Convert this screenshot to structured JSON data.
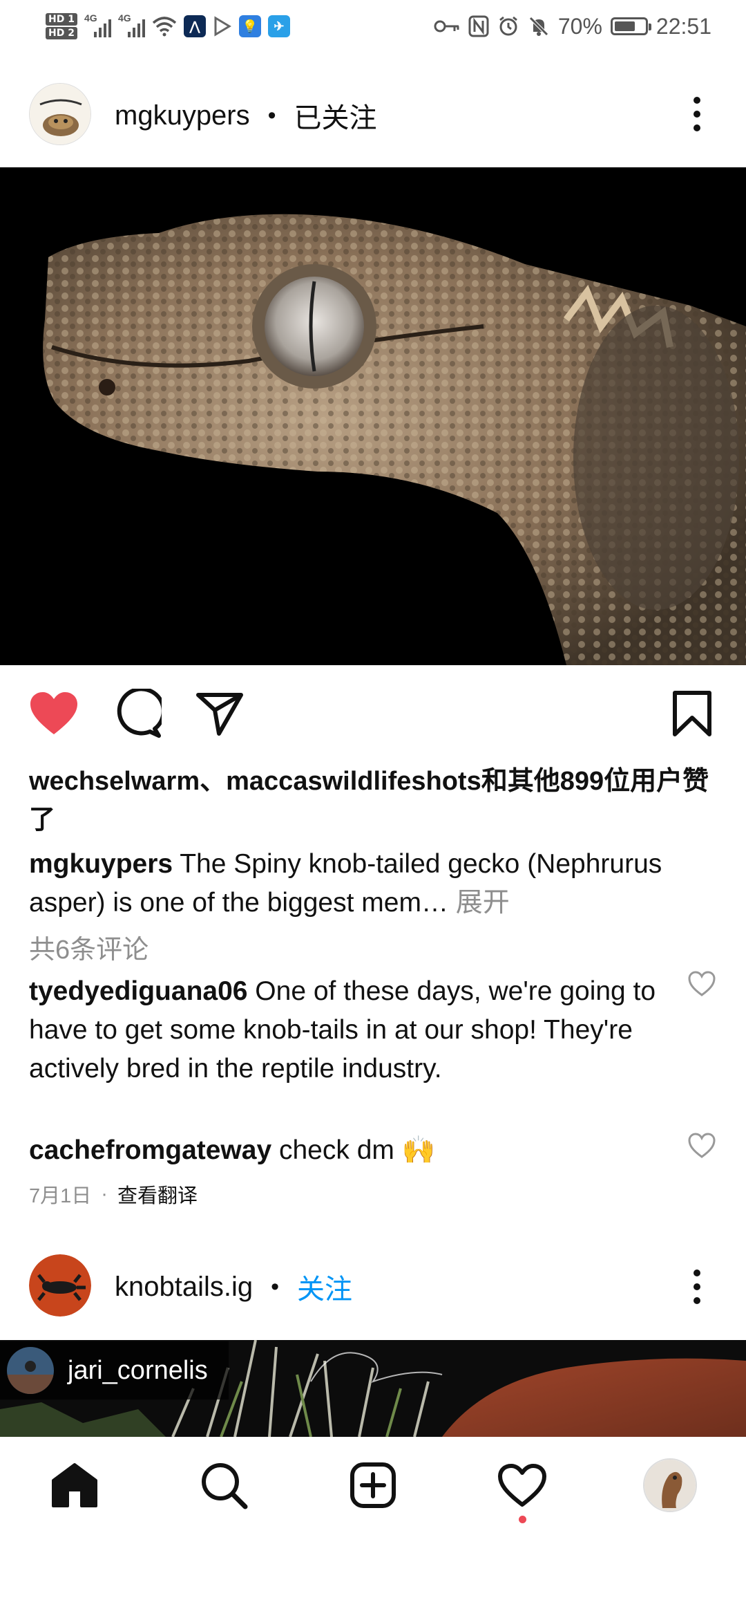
{
  "status_bar": {
    "hd1": "HD 1",
    "hd2": "HD 2",
    "signal1_label": "4G",
    "signal2_label": "4G",
    "battery_percent": "70%",
    "battery_level": 0.7,
    "time": "22:51"
  },
  "post1": {
    "username": "mgkuypers",
    "separator": "•",
    "follow_status": "已关注",
    "liked_by": "wechselwarm、maccaswildlifeshots和其他899位用户赞了",
    "caption_username": "mgkuypers",
    "caption_text": " The Spiny knob-tailed gecko (Nephrurus asper) is one of the biggest mem…",
    "caption_expand": " 展开",
    "view_all_comments": "共6条评论",
    "comments": [
      {
        "username": "tyedyediguana06",
        "text": " One of these days, we're going to have to get some knob-tails in at our shop! They're actively bred in the reptile industry."
      },
      {
        "username": "cachefromgateway",
        "text": " check dm 🙌"
      }
    ],
    "date": "7月1日",
    "meta_separator": "·",
    "translate": "查看翻译",
    "liked": true
  },
  "post2": {
    "username": "knobtails.ig",
    "separator": "•",
    "follow_action": "关注",
    "tagged_user": "jari_cornelis"
  },
  "colors": {
    "like_red": "#ed4956",
    "follow_blue": "#0095f6",
    "secondary_gray": "#8e8e8e",
    "text": "#111111"
  },
  "icons": {
    "like": "heart-filled-icon",
    "comment": "comment-bubble-icon",
    "share": "paper-plane-icon",
    "save": "bookmark-icon",
    "more": "more-vertical-icon",
    "home": "home-icon",
    "search": "search-icon",
    "create": "plus-square-icon",
    "activity": "heart-icon",
    "profile": "profile-avatar"
  }
}
